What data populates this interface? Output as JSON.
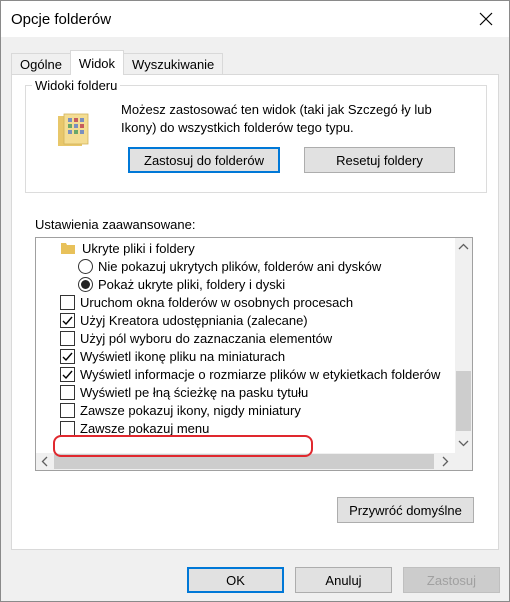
{
  "window": {
    "title": "Opcje folderów"
  },
  "tabs": [
    {
      "label": "Ogólne"
    },
    {
      "label": "Widok"
    },
    {
      "label": "Wyszukiwanie"
    }
  ],
  "folder_views": {
    "legend": "Widoki folderu",
    "desc_line1": "Możesz zastosować ten widok (taki jak Szczegó ły lub",
    "desc_line2": "Ikony) do wszystkich folderów tego typu.",
    "apply_label": "Zastosuj do folderów",
    "reset_label": "Resetuj foldery"
  },
  "advanced": {
    "label": "Ustawienia zaawansowane:",
    "items": [
      {
        "type": "folder",
        "label": "Ukryte pliki i foldery"
      },
      {
        "type": "radio",
        "checked": false,
        "label": "Nie pokazuj ukrytych plików, folderów ani dysków"
      },
      {
        "type": "radio",
        "checked": true,
        "label": "Pokaż ukryte pliki, foldery i dyski"
      },
      {
        "type": "checkbox",
        "checked": false,
        "label": "Uruchom okna folderów w osobnych procesach"
      },
      {
        "type": "checkbox",
        "checked": true,
        "label": "Użyj Kreatora udostępniania (zalecane)"
      },
      {
        "type": "checkbox",
        "checked": false,
        "label": "Użyj pól wyboru do zaznaczania elementów"
      },
      {
        "type": "checkbox",
        "checked": true,
        "label": "Wyświetl ikonę pliku na miniaturach"
      },
      {
        "type": "checkbox",
        "checked": true,
        "label": "Wyświetl informacje o rozmiarze plików w etykietkach folderów"
      },
      {
        "type": "checkbox",
        "checked": false,
        "label": "Wyświetl pe łną ścieżkę na pasku tytułu"
      },
      {
        "type": "checkbox",
        "checked": false,
        "label": "Zawsze pokazuj ikony, nigdy miniatury"
      },
      {
        "type": "checkbox",
        "checked": false,
        "label": "Zawsze pokazuj menu"
      }
    ]
  },
  "restore_label": "Przywróć domyślne",
  "footer": {
    "ok": "OK",
    "cancel": "Anuluj",
    "apply": "Zastosuj"
  },
  "colors": {
    "accent": "#0078d7",
    "highlight": "#e0282e"
  }
}
